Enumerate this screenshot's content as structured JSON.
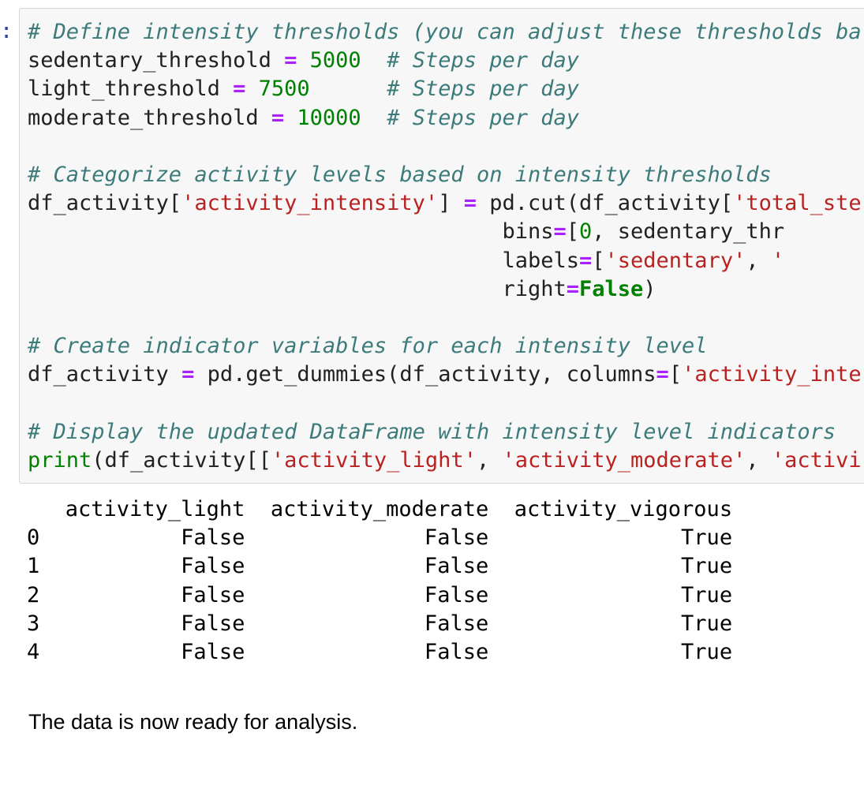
{
  "cell": {
    "prompt": ":",
    "code_lines": [
      [
        {
          "t": "comment",
          "v": "# Define intensity thresholds (you can adjust these thresholds ba"
        }
      ],
      [
        {
          "t": "plain",
          "v": "sedentary_threshold "
        },
        {
          "t": "op",
          "v": "="
        },
        {
          "t": "plain",
          "v": " "
        },
        {
          "t": "num",
          "v": "5000"
        },
        {
          "t": "plain",
          "v": "  "
        },
        {
          "t": "comment",
          "v": "# Steps per day"
        }
      ],
      [
        {
          "t": "plain",
          "v": "light_threshold "
        },
        {
          "t": "op",
          "v": "="
        },
        {
          "t": "plain",
          "v": " "
        },
        {
          "t": "num",
          "v": "7500"
        },
        {
          "t": "plain",
          "v": "      "
        },
        {
          "t": "comment",
          "v": "# Steps per day"
        }
      ],
      [
        {
          "t": "plain",
          "v": "moderate_threshold "
        },
        {
          "t": "op",
          "v": "="
        },
        {
          "t": "plain",
          "v": " "
        },
        {
          "t": "num",
          "v": "10000"
        },
        {
          "t": "plain",
          "v": "  "
        },
        {
          "t": "comment",
          "v": "# Steps per day"
        }
      ],
      [],
      [
        {
          "t": "comment",
          "v": "# Categorize activity levels based on intensity thresholds"
        }
      ],
      [
        {
          "t": "plain",
          "v": "df_activity["
        },
        {
          "t": "str",
          "v": "'activity_intensity'"
        },
        {
          "t": "plain",
          "v": "] "
        },
        {
          "t": "op",
          "v": "="
        },
        {
          "t": "plain",
          "v": " pd.cut(df_activity["
        },
        {
          "t": "str",
          "v": "'total_ste"
        }
      ],
      [
        {
          "t": "plain",
          "v": "                                     bins"
        },
        {
          "t": "op",
          "v": "="
        },
        {
          "t": "plain",
          "v": "["
        },
        {
          "t": "num",
          "v": "0"
        },
        {
          "t": "plain",
          "v": ", sedentary_thr"
        }
      ],
      [
        {
          "t": "plain",
          "v": "                                     labels"
        },
        {
          "t": "op",
          "v": "="
        },
        {
          "t": "plain",
          "v": "["
        },
        {
          "t": "str",
          "v": "'sedentary'"
        },
        {
          "t": "plain",
          "v": ", "
        },
        {
          "t": "str",
          "v": "'"
        }
      ],
      [
        {
          "t": "plain",
          "v": "                                     right"
        },
        {
          "t": "op",
          "v": "="
        },
        {
          "t": "kw",
          "v": "False"
        },
        {
          "t": "plain",
          "v": ")"
        }
      ],
      [],
      [
        {
          "t": "comment",
          "v": "# Create indicator variables for each intensity level"
        }
      ],
      [
        {
          "t": "plain",
          "v": "df_activity "
        },
        {
          "t": "op",
          "v": "="
        },
        {
          "t": "plain",
          "v": " pd.get_dummies(df_activity, columns"
        },
        {
          "t": "op",
          "v": "="
        },
        {
          "t": "plain",
          "v": "["
        },
        {
          "t": "str",
          "v": "'activity_inte"
        }
      ],
      [],
      [
        {
          "t": "comment",
          "v": "# Display the updated DataFrame with intensity level indicators"
        }
      ],
      [
        {
          "t": "builtin",
          "v": "print"
        },
        {
          "t": "plain",
          "v": "(df_activity[["
        },
        {
          "t": "str",
          "v": "'activity_light'"
        },
        {
          "t": "plain",
          "v": ", "
        },
        {
          "t": "str",
          "v": "'activity_moderate'"
        },
        {
          "t": "plain",
          "v": ", "
        },
        {
          "t": "str",
          "v": "'activi"
        }
      ]
    ]
  },
  "output": {
    "columns": [
      "activity_light",
      "activity_moderate",
      "activity_vigorous"
    ],
    "rows": [
      {
        "index": "0",
        "values": [
          "False",
          "False",
          "True"
        ]
      },
      {
        "index": "1",
        "values": [
          "False",
          "False",
          "True"
        ]
      },
      {
        "index": "2",
        "values": [
          "False",
          "False",
          "True"
        ]
      },
      {
        "index": "3",
        "values": [
          "False",
          "False",
          "True"
        ]
      },
      {
        "index": "4",
        "values": [
          "False",
          "False",
          "True"
        ]
      }
    ]
  },
  "markdown": {
    "text": "The data is now ready for analysis."
  }
}
